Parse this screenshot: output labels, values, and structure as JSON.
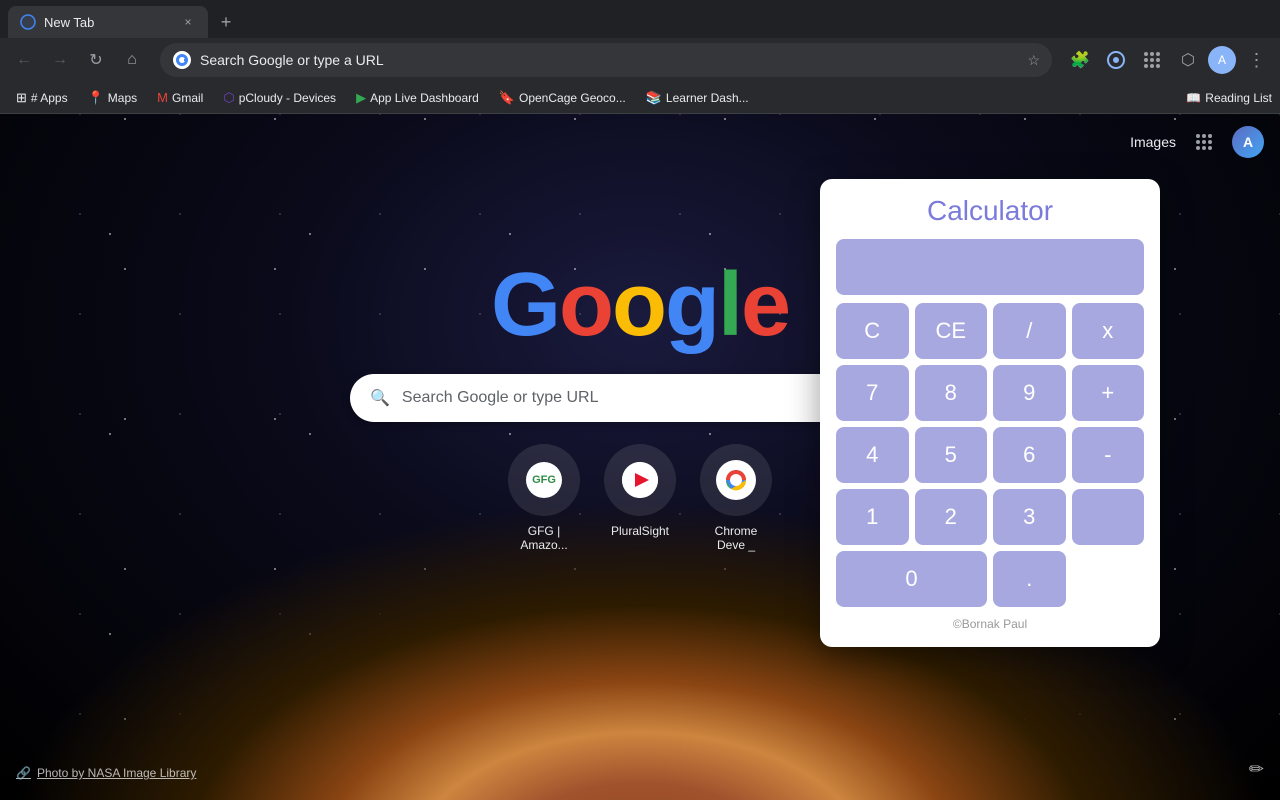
{
  "browser": {
    "tab": {
      "favicon": "chrome-icon",
      "title": "New Tab",
      "close_label": "×"
    },
    "new_tab_label": "+",
    "address": "Search Google or type a URL",
    "back_btn": "←",
    "forward_btn": "→",
    "reload_btn": "↻",
    "home_btn": "⌂",
    "star_btn": "☆",
    "extensions_btn": "⬡",
    "menu_btn": "⋮"
  },
  "bookmarks": [
    {
      "id": "apps",
      "icon": "⊞",
      "label": "# Apps"
    },
    {
      "id": "maps",
      "icon": "📍",
      "label": "Maps"
    },
    {
      "id": "gmail",
      "icon": "✉",
      "label": "Gmail"
    },
    {
      "id": "pcloudy",
      "icon": "☁",
      "label": "pCloudy - Devices"
    },
    {
      "id": "applive",
      "icon": "▶",
      "label": "App Live Dashboard"
    },
    {
      "id": "opencage",
      "icon": "🔖",
      "label": "OpenCage Geoco..."
    },
    {
      "id": "learner",
      "icon": "📚",
      "label": "Learner Dash..."
    }
  ],
  "reading_list": {
    "icon": "📖",
    "label": "Reading List"
  },
  "page": {
    "google_logo": [
      "G",
      "o",
      "o",
      "g",
      "l",
      "e"
    ],
    "search_placeholder": "Search Google or type URL",
    "shortcuts": [
      {
        "id": "gfg",
        "label": "GFG | Amazo...",
        "icon_text": "GFG"
      },
      {
        "id": "pluralsight",
        "label": "PluralSight",
        "icon_text": "▶"
      },
      {
        "id": "chromedev",
        "label": "Chrome Deve _",
        "icon_text": "⊙"
      }
    ],
    "photo_credit": "Photo by NASA Image Library",
    "google_header": {
      "images_label": "Images",
      "apps_icon": "grid",
      "profile_initial": "A"
    }
  },
  "calculator": {
    "title": "Calculator",
    "display": "",
    "buttons": [
      {
        "id": "clear",
        "label": "C"
      },
      {
        "id": "ce",
        "label": "CE"
      },
      {
        "id": "divide",
        "label": "/"
      },
      {
        "id": "multiply",
        "label": "x"
      },
      {
        "id": "seven",
        "label": "7"
      },
      {
        "id": "eight",
        "label": "8"
      },
      {
        "id": "nine",
        "label": "9"
      },
      {
        "id": "add",
        "label": "+"
      },
      {
        "id": "four",
        "label": "4"
      },
      {
        "id": "five",
        "label": "5"
      },
      {
        "id": "six",
        "label": "6"
      },
      {
        "id": "subtract",
        "label": "-"
      },
      {
        "id": "one",
        "label": "1"
      },
      {
        "id": "two",
        "label": "2"
      },
      {
        "id": "three",
        "label": "3"
      },
      {
        "id": "zero",
        "label": "0",
        "span": 2
      },
      {
        "id": "decimal",
        "label": "."
      },
      {
        "id": "equals",
        "label": "=",
        "rowspan": 2
      }
    ],
    "footer": "©Bornak Paul"
  }
}
